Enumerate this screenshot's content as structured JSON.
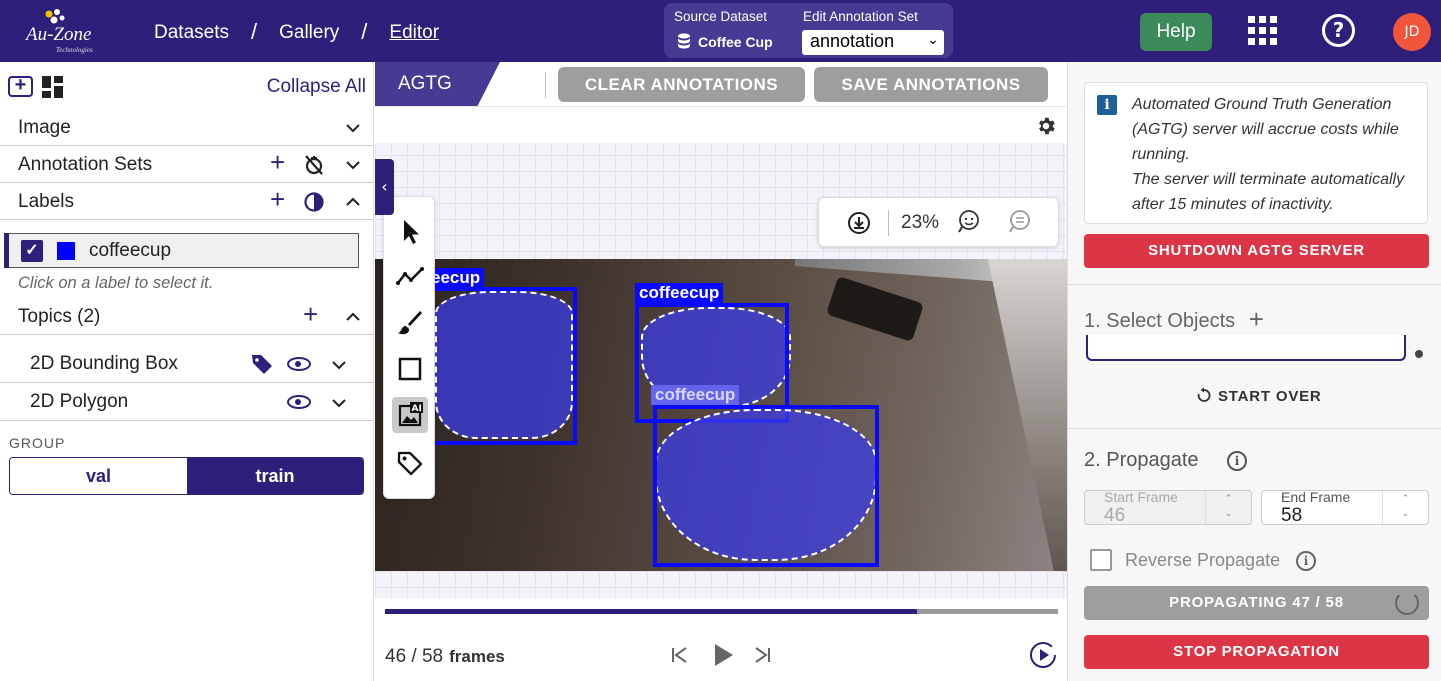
{
  "logo": {
    "text": "Au-Zone",
    "sub": "Technologies"
  },
  "breadcrumb": [
    "Datasets",
    "Gallery",
    "Editor"
  ],
  "dataset": {
    "source_label": "Source Dataset",
    "source_value": "Coffee Cup",
    "annotation_label": "Edit Annotation Set",
    "annotation_value": "annotation"
  },
  "header": {
    "help": "Help",
    "avatar": "JD"
  },
  "left_panel": {
    "collapse_all": "Collapse All",
    "sections": {
      "image": "Image",
      "annotation_sets": "Annotation Sets",
      "labels": "Labels",
      "topics": "Topics (2)"
    },
    "label_item": {
      "name": "coffeecup",
      "color": "#0000ff",
      "checked": true
    },
    "hint": "Click on a label to select it.",
    "topics": [
      "2D Bounding Box",
      "2D Polygon"
    ],
    "group_label": "GROUP",
    "groups": [
      "val",
      "train"
    ],
    "selected_group": "train"
  },
  "center": {
    "tab": "AGTG",
    "clear_btn": "CLEAR ANNOTATIONS",
    "save_btn": "SAVE ANNOTATIONS",
    "zoom": "23%",
    "annotations": [
      {
        "label": "eecup"
      },
      {
        "label": "coffeecup"
      },
      {
        "label": "coffeecup"
      }
    ],
    "frame_current": "46",
    "frame_total": "58",
    "frame_text": "46 / 58",
    "frames_word": "frames",
    "progress_fraction": 0.79
  },
  "right_panel": {
    "info_text_1": "Automated Ground Truth Generation (AGTG) server will accrue costs while running.",
    "info_text_2": "The server will terminate automatically after 15 minutes of inactivity.",
    "shutdown_btn": "SHUTDOWN AGTG SERVER",
    "section1": "1. Select Objects",
    "start_over": "START OVER",
    "section2": "2. Propagate",
    "start_frame_label": "Start Frame",
    "start_frame_value": "46",
    "end_frame_label": "End Frame",
    "end_frame_value": "58",
    "reverse_label": "Reverse Propagate",
    "propagating_btn": "PROPAGATING 47 / 58",
    "stop_btn": "STOP PROPAGATION"
  },
  "colors": {
    "brand": "#2d1f7a",
    "danger": "#dc3545",
    "box": "#0a0aff"
  },
  "icons": [
    "add-box-icon",
    "dashboard-icon",
    "chevron-down-icon",
    "chevron-up-icon",
    "plus-icon",
    "no-sync-icon",
    "contrast-icon",
    "tag-icon",
    "eye-icon",
    "pointer-icon",
    "polyline-icon",
    "brush-icon",
    "rectangle-icon",
    "ai-image-icon",
    "label-tag-icon",
    "download-icon",
    "zoom-in-icon",
    "zoom-out-icon",
    "gear-icon",
    "skip-previous-icon",
    "play-icon",
    "skip-next-icon",
    "play-circle-icon",
    "info-icon",
    "restart-icon",
    "grid-apps-icon",
    "help-circle-icon"
  ]
}
